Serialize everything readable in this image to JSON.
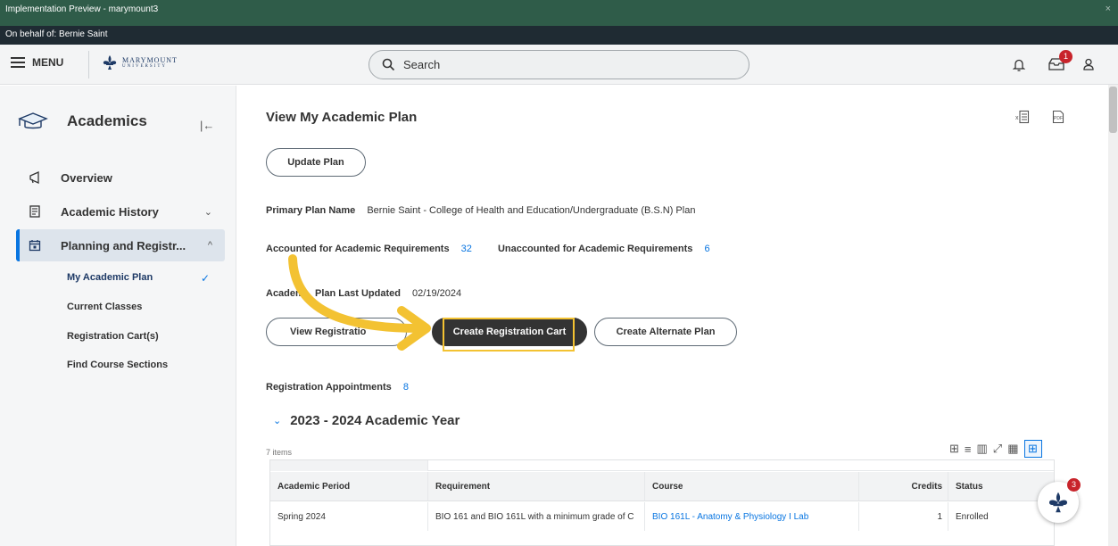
{
  "banner": {
    "preview_text": "Implementation Preview - marymount3",
    "behalf_text": "On behalf of: Bernie Saint",
    "close_glyph": "×"
  },
  "topbar": {
    "menu_label": "MENU",
    "logo_line1": "MARYMOUNT",
    "logo_line2": "UNIVERSITY",
    "search_placeholder": "Search",
    "inbox_count": "1"
  },
  "sidebar": {
    "title": "Academics",
    "items": [
      {
        "label": "Overview",
        "icon": "megaphone-icon"
      },
      {
        "label": "Academic History",
        "icon": "document-icon"
      },
      {
        "label": "Planning and Registr...",
        "icon": "calendar-icon"
      }
    ],
    "subitems": [
      "My Academic Plan",
      "Current Classes",
      "Registration Cart(s)",
      "Find Course Sections"
    ]
  },
  "main": {
    "title": "View My Academic Plan",
    "update_plan_label": "Update Plan",
    "primary_plan_label": "Primary Plan Name",
    "primary_plan_value": "Bernie Saint - College of Health and Education/Undergraduate (B.S.N) Plan",
    "accounted_label": "Accounted for Academic Requirements",
    "accounted_value": "32",
    "unaccounted_label": "Unaccounted for Academic Requirements",
    "unaccounted_value": "6",
    "last_updated_label": "Academ    Plan Last Updated",
    "last_updated_value": "02/19/2024",
    "buttons": {
      "view_registration": "View Registratio",
      "create_cart": "Create Registration Cart",
      "create_alternate": "Create Alternate Plan"
    },
    "appointments_label": "Registration Appointments",
    "appointments_value": "8",
    "year_heading": "2023 - 2024 Academic Year",
    "items_count": "7 items"
  },
  "table": {
    "columns": [
      "Academic Period",
      "Requirement",
      "Course",
      "Credits",
      "Status"
    ],
    "rows": [
      {
        "period": "Spring 2024",
        "requirement": "BIO 161 and BIO 161L with a minimum grade of C",
        "course": "BIO 161L - Anatomy & Physiology I Lab",
        "credits": "1",
        "status": "Enrolled"
      }
    ]
  },
  "fab": {
    "badge": "3"
  },
  "colors": {
    "banner_green": "#2f5c49",
    "banner_dark": "#1f2b33",
    "accent_blue": "#0875e1",
    "highlight_yellow": "#f3c232",
    "badge_red": "#c8242b"
  }
}
